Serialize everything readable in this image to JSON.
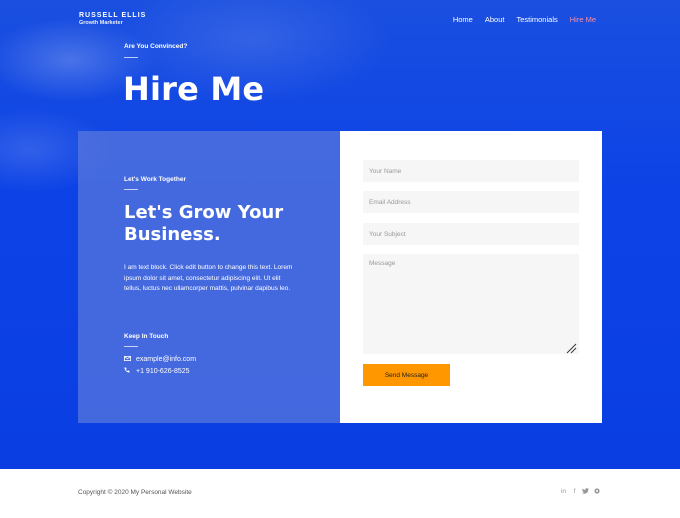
{
  "brand": {
    "name": "RUSSELL ELLIS",
    "subtitle": "Growth Marketer"
  },
  "nav": {
    "items": [
      {
        "label": "Home"
      },
      {
        "label": "About"
      },
      {
        "label": "Testimonials"
      },
      {
        "label": "Hire Me"
      }
    ],
    "active_color": "#ff8fa0"
  },
  "hero": {
    "kicker": "Are You Convinced?",
    "title": "Hire Me"
  },
  "left_panel": {
    "kicker": "Let's Work Together",
    "title": "Let's Grow Your Business.",
    "body": "I am text block. Click edit button to change this text. Lorem ipsum dolor sit amet, consectetur adipiscing elit. Ut elit tellus, luctus nec ullamcorper mattis, pulvinar dapibus leo.",
    "keep_heading": "Keep In Touch",
    "email": "example@info.com",
    "phone": "+1 910-626-8525",
    "email_icon": "envelope-icon",
    "phone_icon": "phone-icon"
  },
  "form": {
    "name_placeholder": "Your Name",
    "email_placeholder": "Email Address",
    "subject_placeholder": "Your Subject",
    "message_placeholder": "Message",
    "submit_label": "Send Message",
    "submit_color": "#ff9800"
  },
  "footer": {
    "copyright": "Copyright © 2020 My Personal Website",
    "socials": [
      {
        "icon": "linkedin-icon",
        "glyph": "in"
      },
      {
        "icon": "facebook-icon",
        "glyph": "f"
      },
      {
        "icon": "twitter-icon",
        "glyph": "❦"
      },
      {
        "icon": "website-icon",
        "glyph": "●"
      }
    ]
  },
  "colors": {
    "primary_blue": "#0d43e6",
    "panel_blue": "#5a78dc",
    "accent_orange": "#ff9800"
  }
}
